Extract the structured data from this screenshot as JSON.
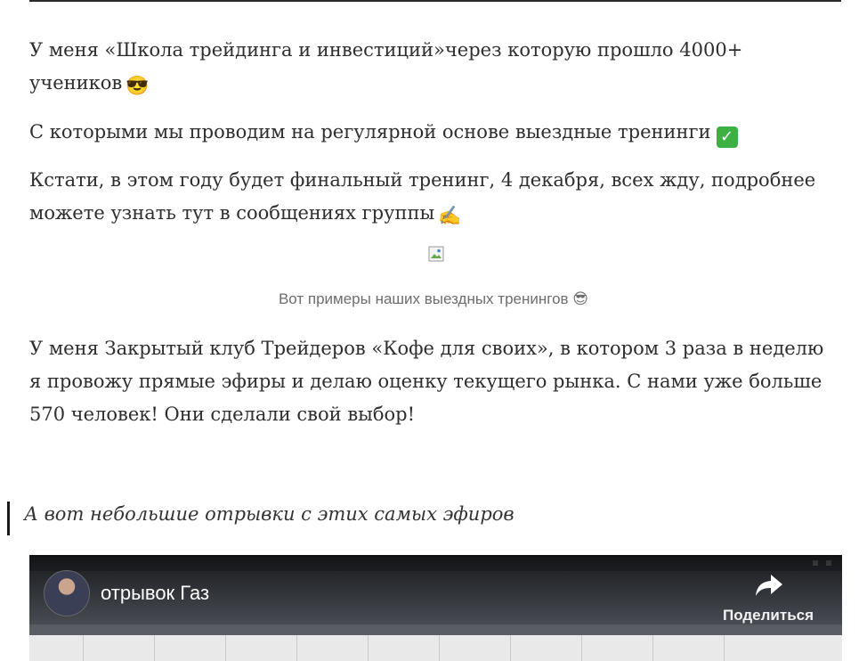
{
  "article": {
    "paragraph1": "У меня «Школа трейдинга и инвестиций»через которую прошло 4000+ учеников",
    "paragraph2": "С которыми мы проводим на регулярной основе выездные тренинги",
    "paragraph3": "Кстати, в этом году будет финальный тренинг, 4 декабря, всех жду, подробнее можете узнать тут в сообщениях группы",
    "image_caption": "Вот примеры наших выездных тренингов",
    "paragraph4": "У меня Закрытый клуб Трейдеров «Кофе для своих», в котором 3 раза в неделю я провожу прямые эфиры и делаю оценку текущего рынка. С нами уже больше 570 человек! Они сделали свой выбор!",
    "quote": "А вот небольшие отрывки с этих самых эфиров"
  },
  "emojis": {
    "sunglasses": "😎",
    "check": "✓",
    "writing_hand": "✍"
  },
  "video": {
    "title": "отрывок Газ",
    "share_label": "Поделиться"
  },
  "colors": {
    "text": "#2e2e2e",
    "caption": "#6e6e6e",
    "check_green": "#3cb043"
  }
}
